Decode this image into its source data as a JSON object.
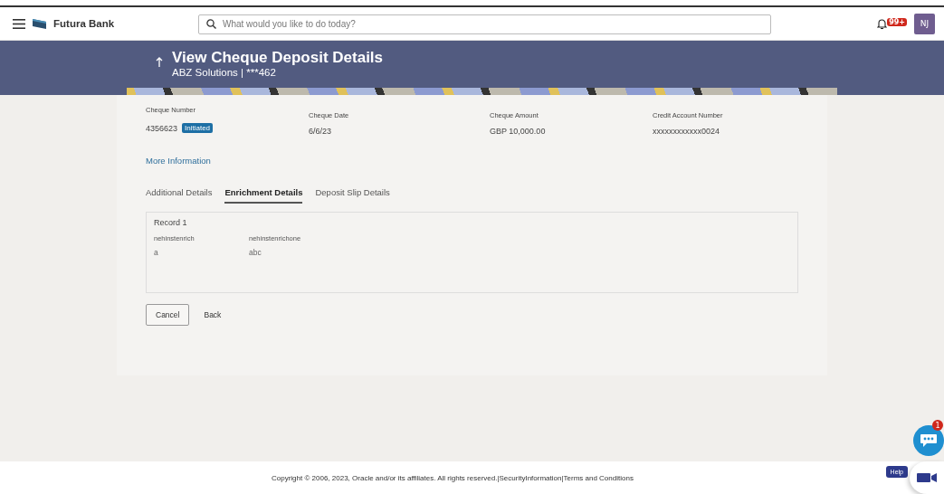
{
  "header": {
    "brand": "Futura Bank",
    "search": {
      "placeholder": "What would you like to do today?"
    },
    "notification_badge": "99+",
    "avatar": "NJ"
  },
  "page": {
    "title": "View Cheque Deposit Details",
    "subtitle": "ABZ Solutions | ***462"
  },
  "summary": [
    {
      "label": "Cheque Number",
      "value": "4356623",
      "status": "Initiated"
    },
    {
      "label": "Cheque Date",
      "value": "6/6/23"
    },
    {
      "label": "Cheque Amount",
      "value": "GBP 10,000.00"
    },
    {
      "label": "Credit Account Number",
      "value": "xxxxxxxxxxxx0024"
    }
  ],
  "more_link": "More Information",
  "tabs": [
    {
      "label": "Additional Details",
      "selected": false
    },
    {
      "label": "Enrichment Details",
      "selected": true
    },
    {
      "label": "Deposit Slip Details",
      "selected": false
    }
  ],
  "record": {
    "title": "Record 1",
    "fields": [
      {
        "label": "nehinstenrich",
        "value": "a"
      },
      {
        "label": "nehinstenrichone",
        "value": "abc"
      }
    ]
  },
  "buttons": [
    "Cancel",
    "Back"
  ],
  "chat_badge": "1",
  "help": "Help",
  "footer": {
    "copyright": "Copyright © 2006, 2023, Oracle and/or its affiliates. All rights reserved.|",
    "links": [
      "SecurityInformation",
      "|",
      "Terms and Conditions"
    ]
  }
}
